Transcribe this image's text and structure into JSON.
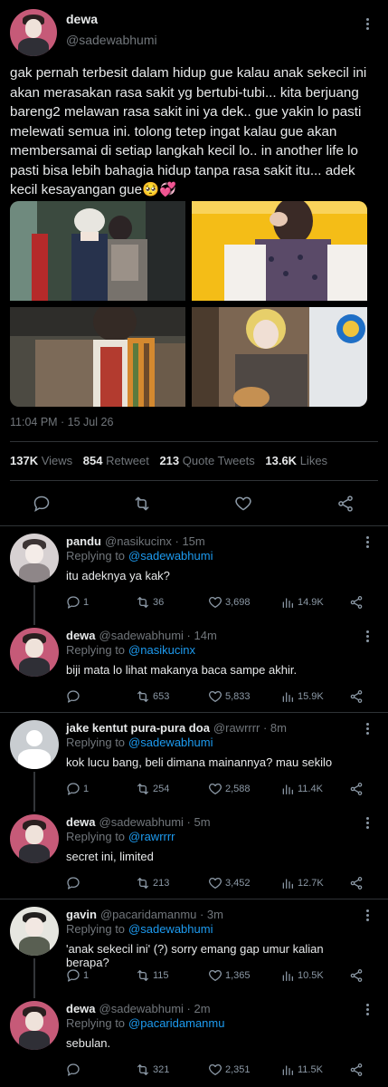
{
  "main_tweet": {
    "name": "dewa",
    "handle": "@sadewabhumi",
    "text": "gak pernah terbesit dalam hidup gue kalau anak sekecil ini akan merasakan rasa sakit yg bertubi-tubi... kita berjuang bareng2 melawan rasa sakit ini ya dek.. gue yakin lo pasti melewati semua ini. tolong tetep ingat kalau gue akan membersamai di setiap langkah kecil lo.. in another life lo pasti bisa lebih bahagia hidup tanpa rasa sakit itu... adek kecil kesayangan gue🥺💞",
    "time": "11:04 PM · 15 Jul 26",
    "views_count": "137K",
    "views_label": "Views",
    "retweets_count": "854",
    "retweets_label": "Retweet",
    "quotes_count": "213",
    "quotes_label": "Quote Tweets",
    "likes_count": "13.6K",
    "likes_label": "Likes"
  },
  "replies": [
    {
      "name": "pandu",
      "handle": "@nasikucinx · 15m",
      "replying_prefix": "Replying to",
      "replying_to": "@sadewabhumi",
      "text": "itu adeknya ya kak?",
      "reply_count": "1",
      "retweet_count": "36",
      "like_count": "3,698",
      "view_count": "14.9K"
    },
    {
      "name": "dewa",
      "handle": "@sadewabhumi · 14m",
      "replying_prefix": "Replying to",
      "replying_to": "@nasikucinx",
      "text": "biji mata lo lihat makanya baca sampe akhir.",
      "reply_count": "",
      "retweet_count": "653",
      "like_count": "5,833",
      "view_count": "15.9K"
    },
    {
      "name": "jake kentut pura-pura doa",
      "handle": "@rawrrrr · 8m",
      "replying_prefix": "Replying to",
      "replying_to": "@sadewabhumi",
      "text": "kok lucu bang, beli dimana mainannya? mau sekilo",
      "reply_count": "1",
      "retweet_count": "254",
      "like_count": "2,588",
      "view_count": "11.4K"
    },
    {
      "name": "dewa",
      "handle": "@sadewabhumi · 5m",
      "replying_prefix": "Replying to",
      "replying_to": "@rawrrrr",
      "text": "secret ini, limited",
      "reply_count": "",
      "retweet_count": "213",
      "like_count": "3,452",
      "view_count": "12.7K"
    },
    {
      "name": "gavin",
      "handle": "@pacaridamanmu · 3m",
      "replying_prefix": "Replying to",
      "replying_to": "@sadewabhumi",
      "text": "'anak sekecil ini' (?) sorry emang gap umur kalian berapa?",
      "reply_count": "1",
      "retweet_count": "115",
      "like_count": "1,365",
      "view_count": "10.5K"
    },
    {
      "name": "dewa",
      "handle": "@sadewabhumi · 2m",
      "replying_prefix": "Replying to",
      "replying_to": "@pacaridamanmu",
      "text": "sebulan.",
      "reply_count": "",
      "retweet_count": "321",
      "like_count": "2,351",
      "view_count": "11.5K"
    }
  ],
  "icons": {
    "reply": "reply-icon",
    "retweet": "retweet-icon",
    "like": "heart-icon",
    "views": "views-icon",
    "share": "share-icon",
    "more": "more-icon"
  },
  "colors": {
    "background": "#000000",
    "text": "#e7e9ea",
    "muted": "#71767b",
    "link": "#1d9bf0",
    "divider": "#2f3336"
  }
}
